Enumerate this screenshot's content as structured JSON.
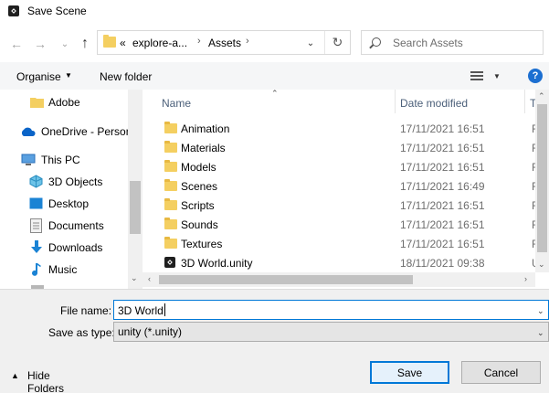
{
  "window": {
    "title": "Save Scene"
  },
  "nav": {
    "address_segments": [
      "explore-a...",
      "Assets"
    ],
    "overflow_label": "«",
    "search_placeholder": "Search Assets"
  },
  "toolbar": {
    "organise_label": "Organise",
    "new_folder_label": "New folder",
    "help_label": "?"
  },
  "sidebar": {
    "items": [
      {
        "label": "Adobe",
        "icon": "folder-icon"
      },
      {
        "label": "OneDrive - Person",
        "icon": "onedrive-cloud-icon"
      },
      {
        "label": "This PC",
        "icon": "computer-icon"
      },
      {
        "label": "3D Objects",
        "icon": "3d-objects-icon"
      },
      {
        "label": "Desktop",
        "icon": "desktop-icon"
      },
      {
        "label": "Documents",
        "icon": "documents-icon"
      },
      {
        "label": "Downloads",
        "icon": "downloads-icon"
      },
      {
        "label": "Music",
        "icon": "music-icon"
      }
    ]
  },
  "filelist": {
    "columns": {
      "name": "Name",
      "date": "Date modified",
      "type": "Ty"
    },
    "rows": [
      {
        "name": "Animation",
        "date": "17/11/2021 16:51",
        "type": "Fi",
        "icon": "folder-icon"
      },
      {
        "name": "Materials",
        "date": "17/11/2021 16:51",
        "type": "Fi",
        "icon": "folder-icon"
      },
      {
        "name": "Models",
        "date": "17/11/2021 16:51",
        "type": "Fi",
        "icon": "folder-icon"
      },
      {
        "name": "Scenes",
        "date": "17/11/2021 16:49",
        "type": "Fi",
        "icon": "folder-icon"
      },
      {
        "name": "Scripts",
        "date": "17/11/2021 16:51",
        "type": "Fi",
        "icon": "folder-icon"
      },
      {
        "name": "Sounds",
        "date": "17/11/2021 16:51",
        "type": "Fi",
        "icon": "folder-icon"
      },
      {
        "name": "Textures",
        "date": "17/11/2021 16:51",
        "type": "Fi",
        "icon": "folder-icon"
      },
      {
        "name": "3D World.unity",
        "date": "18/11/2021 09:38",
        "type": "Ur",
        "icon": "unity-file-icon"
      }
    ]
  },
  "form": {
    "file_name_label": "File name:",
    "file_name_value": "3D World",
    "save_as_type_label": "Save as type:",
    "save_as_type_value": "unity (*.unity)"
  },
  "footer": {
    "hide_folders_label": "Hide Folders",
    "save_label": "Save",
    "cancel_label": "Cancel"
  },
  "colors": {
    "accent": "#0078d7",
    "folder": "#f4cf61",
    "help": "#1c6fd1"
  }
}
